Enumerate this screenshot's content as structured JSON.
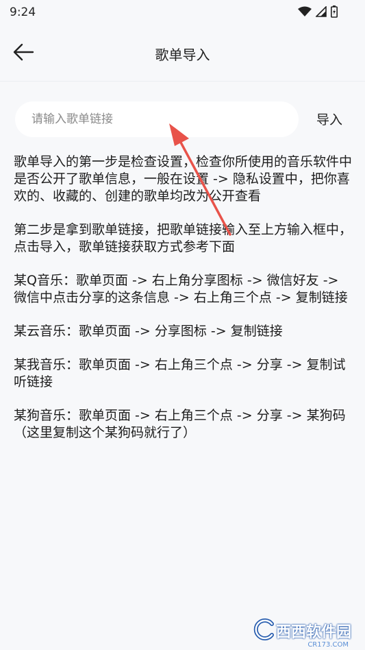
{
  "status_bar": {
    "time": "9:24"
  },
  "header": {
    "title": "歌单导入"
  },
  "search": {
    "placeholder": "请输入歌单链接",
    "import_label": "导入"
  },
  "instructions": [
    "歌单导入的第一步是检查设置，检查你所使用的音乐软件中是否公开了歌单信息，一般在设置 -> 隐私设置中，把你喜欢的、收藏的、创建的歌单均改为公开查看",
    "第二步是拿到歌单链接，把歌单链接输入至上方输入框中，点击导入，歌单链接获取方式参考下面",
    "某Q音乐：歌单页面 -> 右上角分享图标 -> 微信好友 -> 微信中点击分享的这条信息 -> 右上角三个点 -> 复制链接",
    "某云音乐：歌单页面 -> 分享图标 -> 复制链接",
    "某我音乐：歌单页面 -> 右上角三个点 -> 分享 -> 复制试听链接",
    "某狗音乐：歌单页面 -> 右上角三个点 -> 分享 -> 某狗码（这里复制这个某狗码就行了）"
  ],
  "watermark": {
    "text": "西西软件园",
    "sub": "CR173.COM"
  },
  "colors": {
    "background": "#f7f8fa",
    "input_bg": "#ffffff",
    "annotation_arrow": "#e8534a",
    "watermark_blue": "#2a5fb0"
  },
  "icons": {
    "back": "arrow-left-icon",
    "wifi": "wifi-icon",
    "signal": "signal-icon",
    "battery": "battery-icon"
  }
}
